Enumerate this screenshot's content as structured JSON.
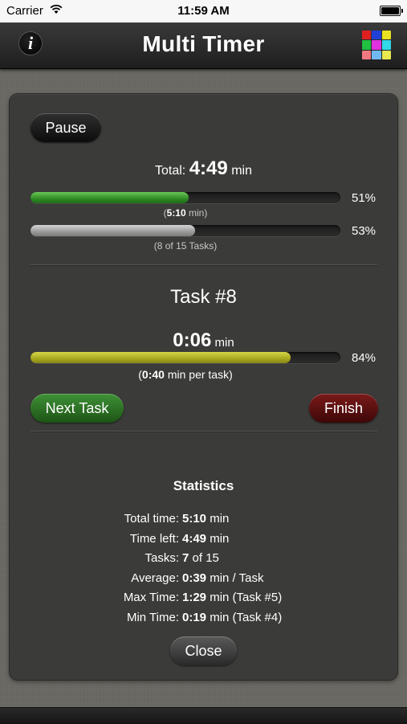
{
  "status_bar": {
    "carrier": "Carrier",
    "time": "11:59 AM"
  },
  "nav": {
    "title": "Multi Timer",
    "info_icon": "i"
  },
  "grid_colors": [
    "#e02020",
    "#2040d8",
    "#e8e020",
    "#20c040",
    "#e030e0",
    "#30d8e8",
    "#f07880",
    "#70b8f0",
    "#e8e850"
  ],
  "controls": {
    "pause_label": "Pause",
    "next_label": "Next Task",
    "finish_label": "Finish",
    "close_label": "Close"
  },
  "total": {
    "label": "Total:",
    "time": "4:49",
    "unit": "min",
    "time_progress": 0.51,
    "time_pct": "51%",
    "time_detail_value": "5:10",
    "time_detail_unit": "min",
    "tasks_progress": 0.53,
    "tasks_pct": "53%",
    "tasks_detail": "(8 of 15 Tasks)"
  },
  "task": {
    "title": "Task #8",
    "time": "0:06",
    "unit": "min",
    "progress": 0.84,
    "pct": "84%",
    "per_task_value": "0:40",
    "per_task_text": "min per task)"
  },
  "stats": {
    "title": "Statistics",
    "rows": [
      {
        "label": "Total time:",
        "value": "5:10",
        "suffix": "min"
      },
      {
        "label": "Time left:",
        "value": "4:49",
        "suffix": "min"
      },
      {
        "label": "Tasks:",
        "value": "7",
        "suffix": "of 15"
      },
      {
        "label": "Average:",
        "value": "0:39",
        "suffix": "min / Task"
      },
      {
        "label": "Max Time:",
        "value": "1:29",
        "suffix": "min (Task #5)"
      },
      {
        "label": "Min Time:",
        "value": "0:19",
        "suffix": "min (Task #4)"
      }
    ]
  }
}
